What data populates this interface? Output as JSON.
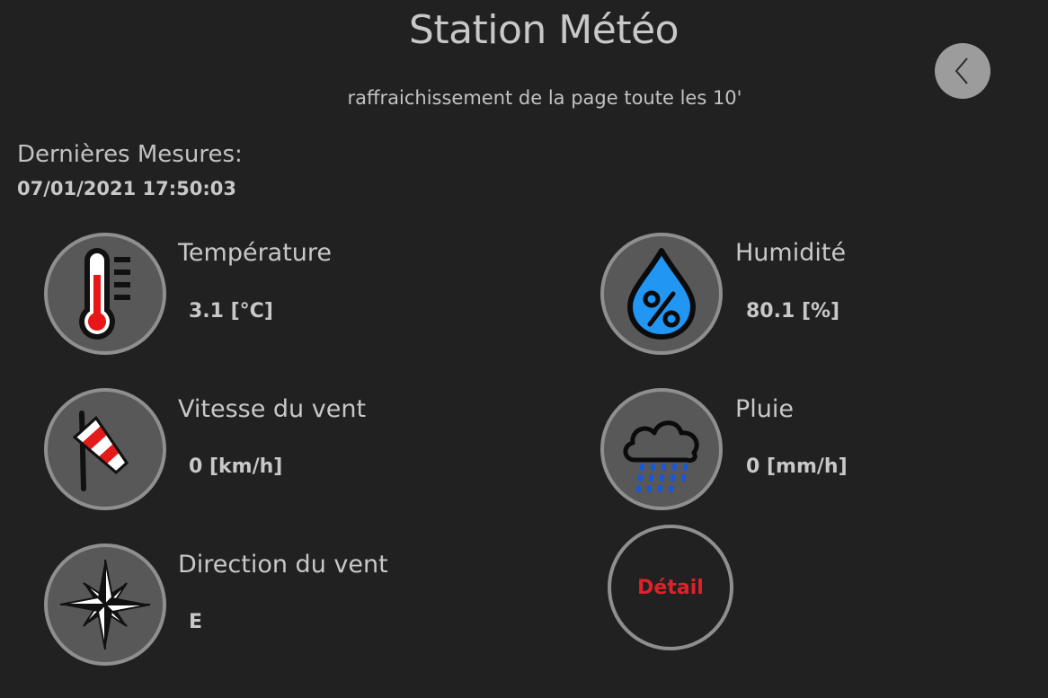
{
  "header": {
    "title": "Station Météo",
    "subtitle": "raffraichissement de la page toute les 10'"
  },
  "measures": {
    "heading": "Dernières Mesures:",
    "timestamp": "07/01/2021 17:50:03"
  },
  "cards": {
    "temperature": {
      "label": "Température",
      "value": "3.1 [°C]"
    },
    "humidity": {
      "label": "Humidité",
      "value": "80.1 [%]"
    },
    "wind_speed": {
      "label": "Vitesse du vent",
      "value": "0 [km/h]"
    },
    "rain": {
      "label": "Pluie",
      "value": "0 [mm/h]"
    },
    "wind_direction": {
      "label": "Direction du vent",
      "value": "E"
    }
  },
  "detail_button": {
    "label": "Détail"
  },
  "icons": {
    "back": "chevron-left-icon",
    "temperature": "thermometer-icon",
    "humidity": "humidity-drop-icon",
    "wind_speed": "windsock-icon",
    "rain": "rain-cloud-icon",
    "wind_direction": "compass-rose-icon"
  },
  "colors": {
    "background": "#212121",
    "text": "#c8c8c8",
    "icon_circle": "#585858",
    "icon_border": "#8f8f8f",
    "detail_red": "#e0212c",
    "drop_blue": "#2196f3",
    "rain_blue": "#1a57d6"
  }
}
